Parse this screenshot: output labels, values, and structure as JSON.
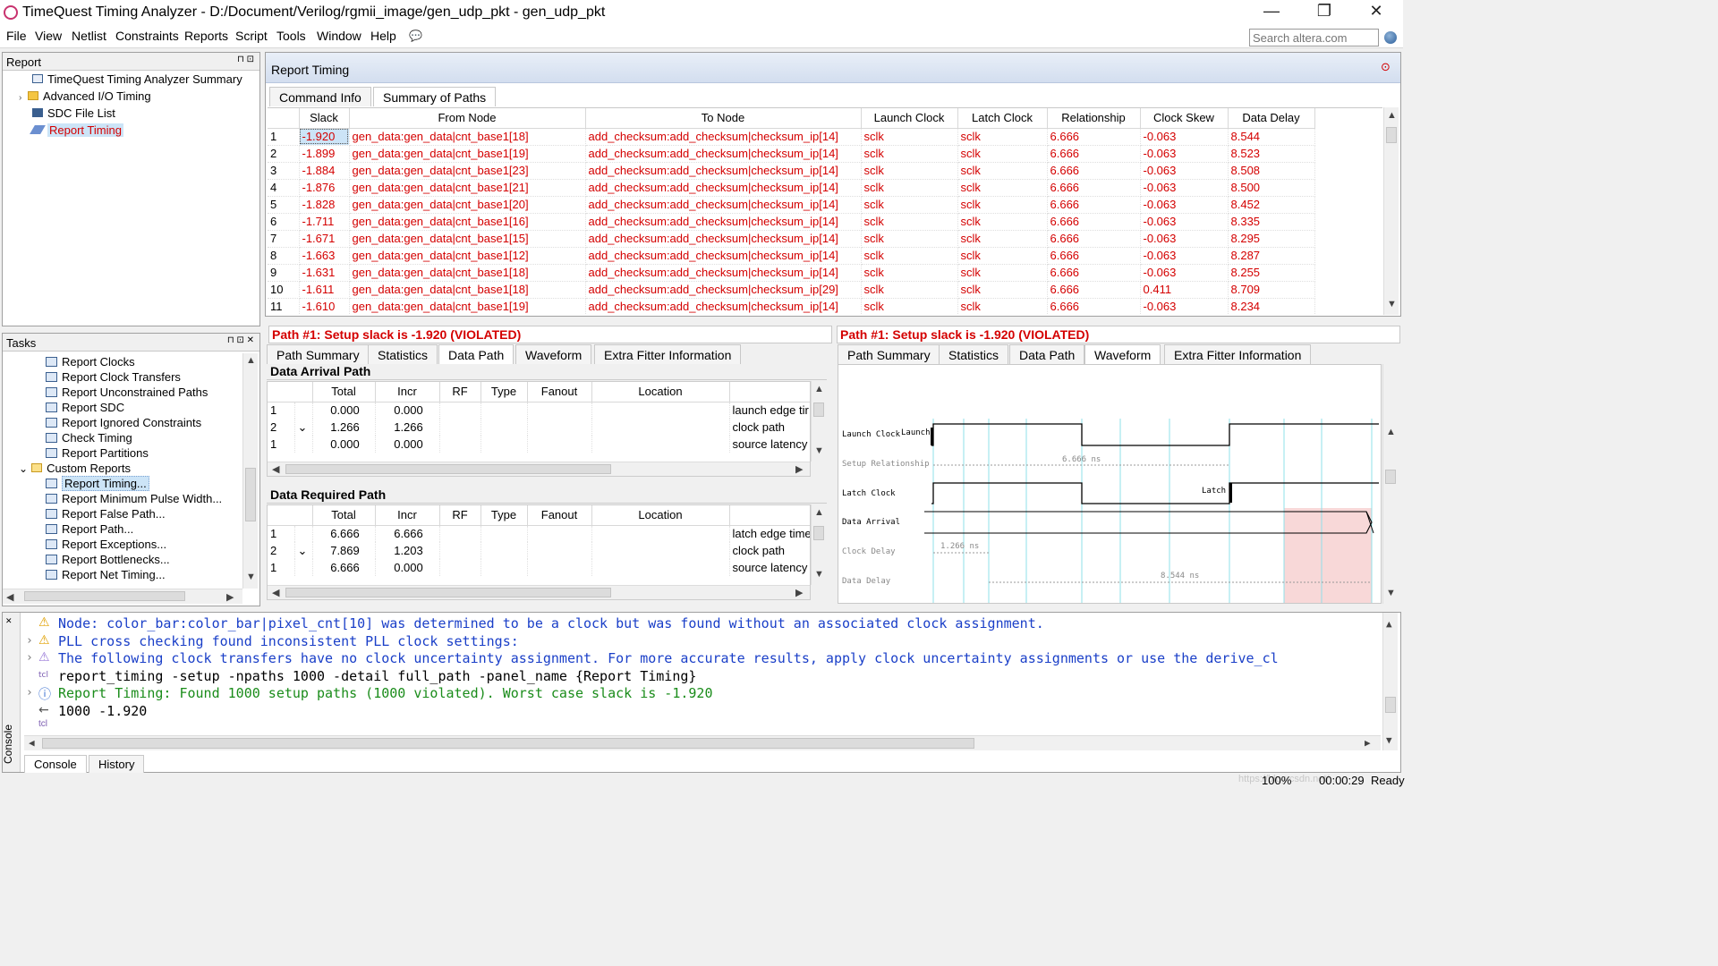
{
  "window": {
    "title": "TimeQuest Timing Analyzer - D:/Document/Verilog/rgmii_image/gen_udp_pkt - gen_udp_pkt",
    "minimize": "—",
    "restore": "❐",
    "close": "✕"
  },
  "menu": [
    "File",
    "View",
    "Netlist",
    "Constraints",
    "Reports",
    "Script",
    "Tools",
    "Window",
    "Help"
  ],
  "search": {
    "placeholder": "Search altera.com"
  },
  "report_panel": {
    "title": "Report",
    "items": [
      {
        "label": "TimeQuest Timing Analyzer Summary",
        "icon": "table-icon"
      },
      {
        "label": "Advanced I/O Timing",
        "icon": "folder-icon"
      },
      {
        "label": "SDC File List",
        "icon": "table-icon"
      },
      {
        "label": "Report Timing",
        "icon": "pencil-icon"
      }
    ]
  },
  "tasks_panel": {
    "title": "Tasks",
    "items": [
      "Report Clocks",
      "Report Clock Transfers",
      "Report Unconstrained Paths",
      "Report SDC",
      "Report Ignored Constraints",
      "Check Timing",
      "Report Partitions",
      "Custom Reports",
      "Report Timing...",
      "Report Minimum Pulse Width...",
      "Report False Path...",
      "Report Path...",
      "Report Exceptions...",
      "Report Bottlenecks...",
      "Report Net Timing..."
    ]
  },
  "report_timing": {
    "title": "Report Timing",
    "tabs": [
      "Command Info",
      "Summary of Paths"
    ],
    "columns": [
      "Slack",
      "From Node",
      "To Node",
      "Launch Clock",
      "Latch Clock",
      "Relationship",
      "Clock Skew",
      "Data Delay"
    ],
    "rows": [
      [
        "1",
        "-1.920",
        "gen_data:gen_data|cnt_base1[18]",
        "add_checksum:add_checksum|checksum_ip[14]",
        "sclk",
        "sclk",
        "6.666",
        "-0.063",
        "8.544"
      ],
      [
        "2",
        "-1.899",
        "gen_data:gen_data|cnt_base1[19]",
        "add_checksum:add_checksum|checksum_ip[14]",
        "sclk",
        "sclk",
        "6.666",
        "-0.063",
        "8.523"
      ],
      [
        "3",
        "-1.884",
        "gen_data:gen_data|cnt_base1[23]",
        "add_checksum:add_checksum|checksum_ip[14]",
        "sclk",
        "sclk",
        "6.666",
        "-0.063",
        "8.508"
      ],
      [
        "4",
        "-1.876",
        "gen_data:gen_data|cnt_base1[21]",
        "add_checksum:add_checksum|checksum_ip[14]",
        "sclk",
        "sclk",
        "6.666",
        "-0.063",
        "8.500"
      ],
      [
        "5",
        "-1.828",
        "gen_data:gen_data|cnt_base1[20]",
        "add_checksum:add_checksum|checksum_ip[14]",
        "sclk",
        "sclk",
        "6.666",
        "-0.063",
        "8.452"
      ],
      [
        "6",
        "-1.711",
        "gen_data:gen_data|cnt_base1[16]",
        "add_checksum:add_checksum|checksum_ip[14]",
        "sclk",
        "sclk",
        "6.666",
        "-0.063",
        "8.335"
      ],
      [
        "7",
        "-1.671",
        "gen_data:gen_data|cnt_base1[15]",
        "add_checksum:add_checksum|checksum_ip[14]",
        "sclk",
        "sclk",
        "6.666",
        "-0.063",
        "8.295"
      ],
      [
        "8",
        "-1.663",
        "gen_data:gen_data|cnt_base1[12]",
        "add_checksum:add_checksum|checksum_ip[14]",
        "sclk",
        "sclk",
        "6.666",
        "-0.063",
        "8.287"
      ],
      [
        "9",
        "-1.631",
        "gen_data:gen_data|cnt_base1[18]",
        "add_checksum:add_checksum|checksum_ip[14]",
        "sclk",
        "sclk",
        "6.666",
        "-0.063",
        "8.255"
      ],
      [
        "10",
        "-1.611",
        "gen_data:gen_data|cnt_base1[18]",
        "add_checksum:add_checksum|checksum_ip[29]",
        "sclk",
        "sclk",
        "6.666",
        "0.411",
        "8.709"
      ],
      [
        "11",
        "-1.610",
        "gen_data:gen_data|cnt_base1[19]",
        "add_checksum:add_checksum|checksum_ip[14]",
        "sclk",
        "sclk",
        "6.666",
        "-0.063",
        "8.234"
      ]
    ]
  },
  "left_detail": {
    "heading": "Path #1: Setup slack is -1.920 (VIOLATED)",
    "tabs": [
      "Path Summary",
      "Statistics",
      "Data Path",
      "Waveform",
      "Extra Fitter Information"
    ],
    "active_tab": "Data Path",
    "arrival": {
      "title": "Data Arrival Path",
      "columns": [
        "Total",
        "Incr",
        "RF",
        "Type",
        "Fanout",
        "Location"
      ],
      "rows": [
        [
          "1",
          "",
          "0.000",
          "0.000",
          "",
          "",
          "",
          "",
          "launch edge tir"
        ],
        [
          "2",
          "⌄",
          "1.266",
          "1.266",
          "",
          "",
          "",
          "",
          "clock path"
        ],
        [
          "1",
          "",
          "0.000",
          "0.000",
          "",
          "",
          "",
          "",
          "source latency"
        ]
      ]
    },
    "required": {
      "title": "Data Required Path",
      "columns": [
        "Total",
        "Incr",
        "RF",
        "Type",
        "Fanout",
        "Location"
      ],
      "rows": [
        [
          "1",
          "",
          "6.666",
          "6.666",
          "",
          "",
          "",
          "",
          "latch edge time"
        ],
        [
          "2",
          "⌄",
          "7.869",
          "1.203",
          "",
          "",
          "",
          "",
          "clock path"
        ],
        [
          "1",
          "",
          "6.666",
          "0.000",
          "",
          "",
          "",
          "",
          "source latency"
        ]
      ]
    }
  },
  "right_detail": {
    "heading": "Path #1: Setup slack is -1.920 (VIOLATED)",
    "tabs": [
      "Path Summary",
      "Statistics",
      "Data Path",
      "Waveform",
      "Extra Fitter Information"
    ],
    "active_tab": "Waveform",
    "waveform": {
      "labels": [
        "Launch Clock",
        "Setup Relationship",
        "Latch Clock",
        "Data Arrival",
        "Clock Delay",
        "Data Delay"
      ],
      "launch_marker": "Launch",
      "latch_marker": "Latch",
      "setup_value": "6.666 ns",
      "clock_delay_value": "1.266 ns",
      "data_delay_value": "8.544 ns"
    }
  },
  "console": {
    "lines": [
      {
        "icon": "warning-icon",
        "text": "Node: color_bar:color_bar|pixel_cnt[10] was determined to be a clock but was found without an associated clock assignment.",
        "color": "#1a3fc8"
      },
      {
        "icon": "warning-icon",
        "text": "PLL cross checking found inconsistent PLL clock settings:",
        "color": "#1a3fc8"
      },
      {
        "icon": "warning-outline-icon",
        "text": "The following clock transfers have no clock uncertainty assignment. For more accurate results, apply clock uncertainty assignments or use the derive_cl",
        "color": "#1a3fc8"
      },
      {
        "icon": "tcl-icon",
        "text": "report_timing -setup -npaths 1000 -detail full_path -panel_name {Report Timing}",
        "color": "#000000"
      },
      {
        "icon": "info-icon",
        "text": "Report Timing: Found 1000 setup paths (1000 violated).  Worst case slack is -1.920",
        "color": "#1a8c1a"
      },
      {
        "icon": "return-arrow-icon",
        "text": "1000 -1.920",
        "color": "#000000"
      }
    ],
    "prompt": "tcl",
    "tabs": [
      "Console",
      "History"
    ],
    "side_label": "Console"
  },
  "status": {
    "zoom": "100%",
    "time": "00:00:29",
    "state": "Ready",
    "watermark": "https://blog.csdn.net/..."
  },
  "colors": {
    "violation": "#d40000",
    "selection": "#cce4f7",
    "header_bar": "#dce6f4"
  }
}
